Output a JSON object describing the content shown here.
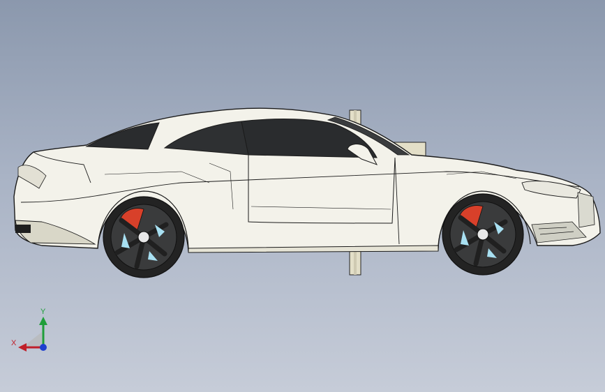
{
  "view": {
    "background_top": "#8b98ad",
    "background_bottom": "#c6ccd8",
    "model_description_icon": "car-body-side-view"
  },
  "triad": {
    "x_label": "X",
    "y_label": "Y",
    "x_color": "#c0202a",
    "y_color": "#1f9e3a",
    "z_color": "#1f3fcf"
  },
  "colors": {
    "body": "#f2f2ec",
    "edge": "#1b1b1b",
    "glass": "#2a2c2e",
    "tire": "#232323",
    "caliper": "#d8402a",
    "rim_highlight": "#a8e0f2"
  }
}
